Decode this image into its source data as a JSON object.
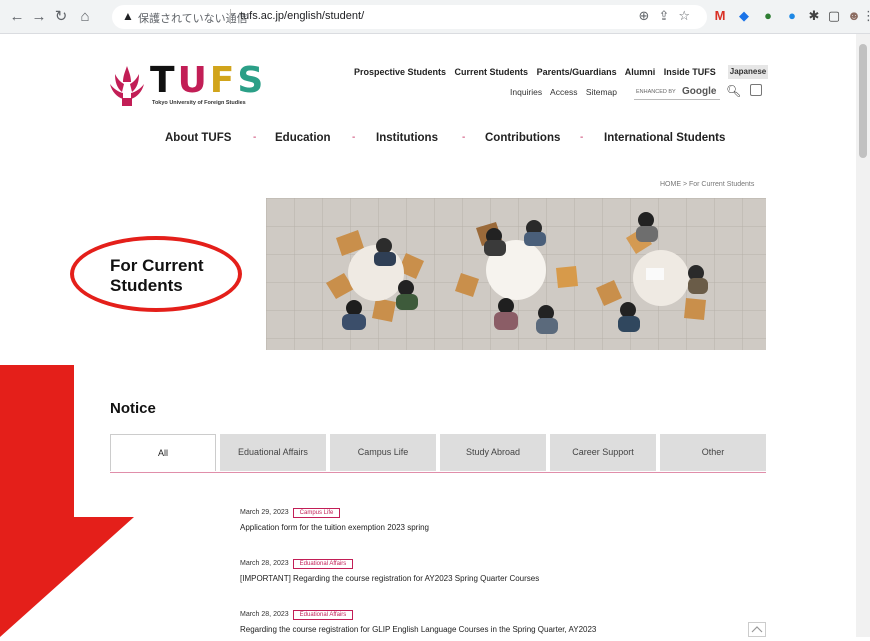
{
  "browser": {
    "security_label": "保護されていない通信",
    "url": "tufs.ac.jp/english/student/"
  },
  "header": {
    "logo_text": "TUFS",
    "logo_subtitle": "Tokyo University of Foreign Studies",
    "top_links": [
      "Prospective Students",
      "Current Students",
      "Parents/Guardians",
      "Alumni",
      "Inside TUFS"
    ],
    "japanese_label": "Japanese",
    "util_links": [
      "Inquiries",
      "Access",
      "Sitemap"
    ],
    "search_enhanced": "ENHANCED BY",
    "search_google": "Google"
  },
  "main_nav": [
    "About TUFS",
    "Education",
    "Institutions",
    "Contributions",
    "International Students"
  ],
  "breadcrumb": "HOME  >  For Current Students",
  "page_title_line1": "For Current",
  "page_title_line2": "Students",
  "notice": {
    "title": "Notice",
    "tabs": [
      "All",
      "Eduational Affairs",
      "Campus Life",
      "Study Abroad",
      "Career Support",
      "Other"
    ],
    "items": [
      {
        "date": "March 29, 2023",
        "tag": "Campus Life",
        "text": "Application form for the tuition exemption 2023 spring"
      },
      {
        "date": "March 28, 2023",
        "tag": "Eduational Affairs",
        "text": "[IMPORTANT] Regarding the course registration for AY2023 Spring Quarter Courses"
      },
      {
        "date": "March 28, 2023",
        "tag": "Eduational Affairs",
        "text": "Regarding the course registration for GLIP English Language Courses in the Spring Quarter, AY2023"
      }
    ]
  },
  "colors": {
    "accent": "#c21e56",
    "annotation_red": "#e41f1a"
  }
}
